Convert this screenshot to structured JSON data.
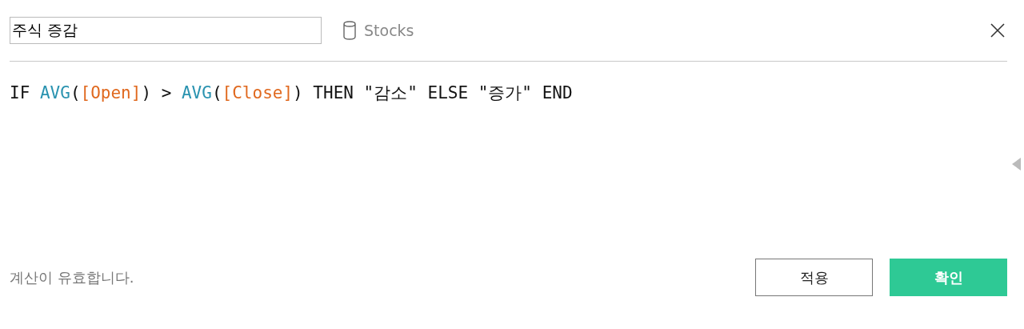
{
  "calculation_name": {
    "value": "주식 증감"
  },
  "data_source": {
    "label": "Stocks"
  },
  "formula": [
    {
      "text": "IF ",
      "kind": "plain"
    },
    {
      "text": "AVG",
      "kind": "function"
    },
    {
      "text": "(",
      "kind": "plain"
    },
    {
      "text": "[Open]",
      "kind": "field"
    },
    {
      "text": ") > ",
      "kind": "plain"
    },
    {
      "text": "AVG",
      "kind": "function"
    },
    {
      "text": "(",
      "kind": "plain"
    },
    {
      "text": "[Close]",
      "kind": "field"
    },
    {
      "text": ") THEN \"감소\" ELSE \"증가\" END",
      "kind": "plain"
    }
  ],
  "status": "계산이 유효합니다.",
  "buttons": [
    {
      "label": "적용",
      "kind": "secondary"
    },
    {
      "label": "확인",
      "kind": "primary"
    }
  ]
}
